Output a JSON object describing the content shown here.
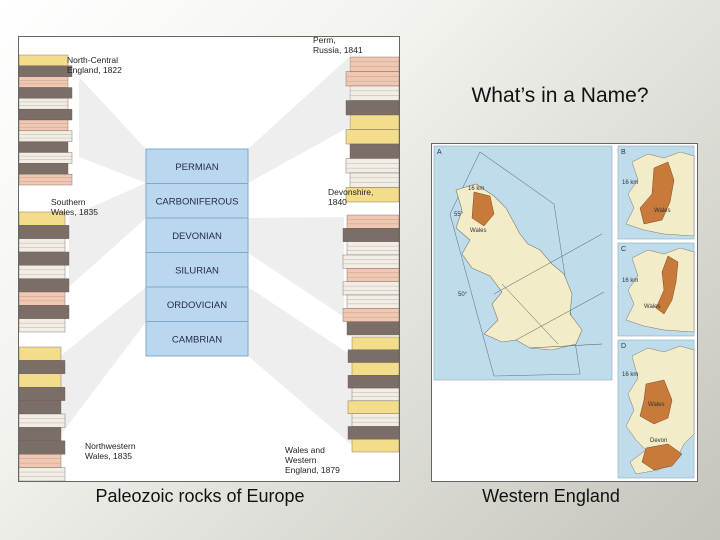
{
  "slide": {
    "title": "What’s in a Name?",
    "caption_left": "Paleozoic rocks of Europe",
    "caption_right": "Western England"
  },
  "left_figure": {
    "periods": [
      "PERMIAN",
      "CARBONIFEROUS",
      "DEVONIAN",
      "SILURIAN",
      "ORDOVICIAN",
      "CAMBRIAN"
    ],
    "localities": [
      {
        "name": "North-Central England",
        "year": "1822"
      },
      {
        "name": "Perm, Russia",
        "year": "1841"
      },
      {
        "name": "Southern Wales",
        "year": "1835"
      },
      {
        "name": "Devonshire",
        "year": "1840"
      },
      {
        "name": "Northwestern Wales",
        "year": "1835"
      },
      {
        "name": "Wales and Western England",
        "year": "1879"
      }
    ],
    "colors": {
      "period_table": "#b9d7ef",
      "period_border": "#7fa8cc",
      "sandstone": "#f3dd8a",
      "shale": "#7a6e66",
      "red_beds": "#f1c7b2",
      "limestone": "#f2eee6"
    }
  },
  "right_figure": {
    "panel_letters": [
      "A",
      "B",
      "C",
      "D"
    ],
    "scale_label": "16 km",
    "labels": {
      "wales": "Wales",
      "devon": "Devon",
      "lat_55": "55°",
      "lat_50": "50°"
    },
    "colors": {
      "sea": "#bfdcec",
      "land": "#f3ecc8",
      "outcrop": "#c77a3a"
    }
  }
}
